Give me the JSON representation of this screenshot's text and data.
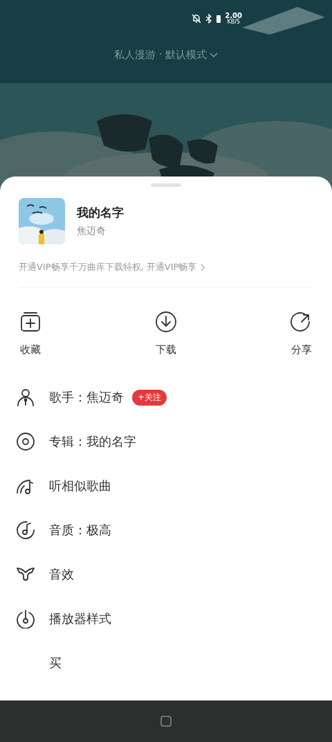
{
  "status_bar": {
    "speed": "2.00",
    "speed_unit": "KB/S"
  },
  "header": {
    "mode": "私人漫游 · 默认模式"
  },
  "sheet": {
    "song": {
      "title": "我的名字",
      "artist": "焦迈奇"
    },
    "vip_promo": "开通VIP畅享千万曲库下载特权, 开通VIP畅享",
    "actions": [
      {
        "kind": "collect",
        "label": "收藏"
      },
      {
        "kind": "download",
        "label": "下载"
      },
      {
        "kind": "share",
        "label": "分享"
      }
    ],
    "menu": [
      {
        "kind": "singer",
        "label": "歌手：焦迈奇",
        "badge": "+关注"
      },
      {
        "kind": "album",
        "label": "专辑：我的名字"
      },
      {
        "kind": "similar",
        "label": "听相似歌曲"
      },
      {
        "kind": "quality",
        "label": "音质：极高"
      },
      {
        "kind": "effect",
        "label": "音效"
      },
      {
        "kind": "player",
        "label": "播放器样式"
      },
      {
        "kind": "buy",
        "label": "买"
      }
    ]
  }
}
